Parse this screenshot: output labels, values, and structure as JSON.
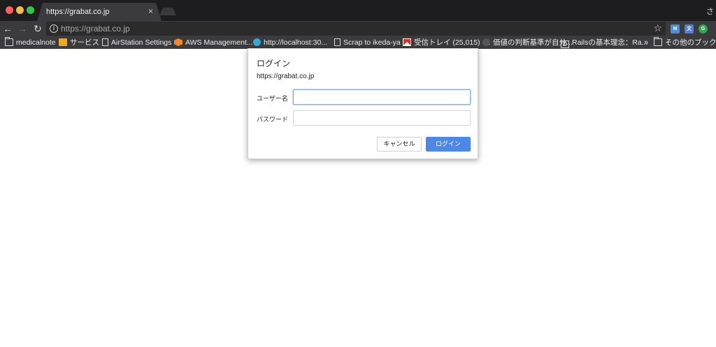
{
  "tab": {
    "title": "https://grabat.co.jp",
    "close_glyph": "×"
  },
  "profile_glyph": "さ",
  "nav": {
    "back_glyph": "←",
    "forward_glyph": "→",
    "reload_glyph": "↻"
  },
  "omnibox": {
    "url": "https://grabat.co.jp",
    "info_glyph": "i",
    "star_glyph": "☆"
  },
  "extensions": [
    {
      "name": "ext-tool-icon",
      "glyph": "M"
    },
    {
      "name": "ext-translate-icon",
      "glyph": "文"
    },
    {
      "name": "ext-grammarly-icon",
      "glyph": "G"
    }
  ],
  "bookmarks": {
    "items": [
      {
        "label": "medicalnote",
        "icon": "folder-icon"
      },
      {
        "label": "サービス",
        "icon": "box-icon"
      },
      {
        "label": "AirStation Settings",
        "icon": "page-icon"
      },
      {
        "label": "AWS Management...",
        "icon": "aws-icon"
      },
      {
        "label": "http://localhost:30...",
        "icon": "globe-icon"
      },
      {
        "label": "Scrap to ikeda-ya",
        "icon": "page-icon"
      },
      {
        "label": "受信トレイ (25,015) -...",
        "icon": "gmail-icon"
      },
      {
        "label": "価値の判断基準が自分...",
        "icon": "site-icon"
      },
      {
        "label": "Railsの基本理念：Ra...",
        "icon": "d-icon"
      }
    ],
    "more_glyph": "»",
    "other_label": "その他のブックマーク"
  },
  "dialog": {
    "title": "ログイン",
    "origin": "https://grabat.co.jp",
    "username_label": "ユーザー名",
    "username_value": "",
    "password_label": "パスワード",
    "password_value": "",
    "cancel_label": "キャンセル",
    "login_label": "ログイン"
  }
}
